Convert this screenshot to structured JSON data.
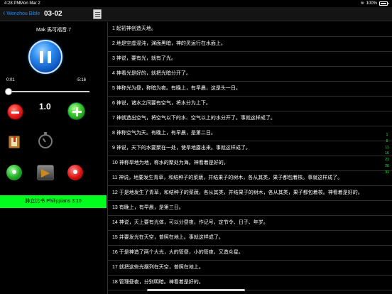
{
  "status_bar": {
    "time": "4:28 PM",
    "date": "Mon Mar 2",
    "battery": "100%"
  },
  "nav": {
    "back_label": "Wenzhou Bible",
    "title": "03-02"
  },
  "player": {
    "book_title": "Mak 馬可福音.7",
    "current_time": "0:01",
    "duration": "-5:16",
    "progress": 0.003,
    "speed": "1.0",
    "reference": "腓立比书 Philippians 3:10"
  },
  "verses": [
    "1 起初神创造天地。",
    "2 地是空虚混沌，渊面黑暗，神的灵运行在水面上。",
    "3 神说，要有光，就有了光。",
    "4 神看光是好的，就把光暗分开了。",
    "5 神称光为昼，称暗为夜。有晚上，有早晨，这是头一日。",
    "6 神说，诸水之间要有空气，将水分为上下。",
    "7 神就造出空气，将空气以下的水、空气以上的水分开了。事就这样成了。",
    "8 神称空气为天。有晚上，有早晨，是第二日。",
    "9 神说，天下的水要聚在一处，使旱地露出来。事就这样成了。",
    "10 神称旱地为地，称水的聚处为海。神看着是好的。",
    "11 神说，地要发生青草，和结种子的菜蔬，并结果子的树木，各从其类，果子都包着核。事就这样成了。",
    "12 于是地发生了青草，和结种子的菜蔬，各从其类，并结果子的树木，各从其类，果子都包着核。神看着是好的。",
    "13 有晚上，有早晨，是第三日。",
    "14 神说，天上要有光体，可以分昼夜，作记号，定节令、日子、年岁。",
    "15 并要发光在天空，普照在地上。事就这样成了。",
    "16 于是神造了两个大光，大的管昼，小的管夜，又造众星。",
    "17 就把这些光摆列在天空，普照在地上。",
    "18 管理昼夜，分别明暗。神看着是好的。"
  ],
  "verse_index": [
    "1",
    "6",
    "11",
    "16",
    "21",
    "26",
    "31"
  ]
}
